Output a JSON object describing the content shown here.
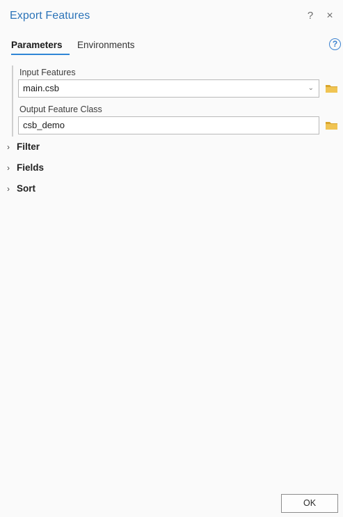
{
  "window": {
    "title": "Export Features",
    "help_glyph": "?",
    "close_glyph": "×"
  },
  "tabs": [
    {
      "label": "Parameters",
      "active": true
    },
    {
      "label": "Environments",
      "active": false
    }
  ],
  "help_icon_glyph": "?",
  "parameters": {
    "input_features": {
      "label": "Input Features",
      "value": "main.csb"
    },
    "output_feature_class": {
      "label": "Output Feature Class",
      "value": "csb_demo"
    }
  },
  "sections": [
    {
      "label": "Filter"
    },
    {
      "label": "Fields"
    },
    {
      "label": "Sort"
    }
  ],
  "ok_label": "OK",
  "colors": {
    "accent": "#2f86d6",
    "title": "#2b73b8",
    "folder": "#e6b43c"
  }
}
